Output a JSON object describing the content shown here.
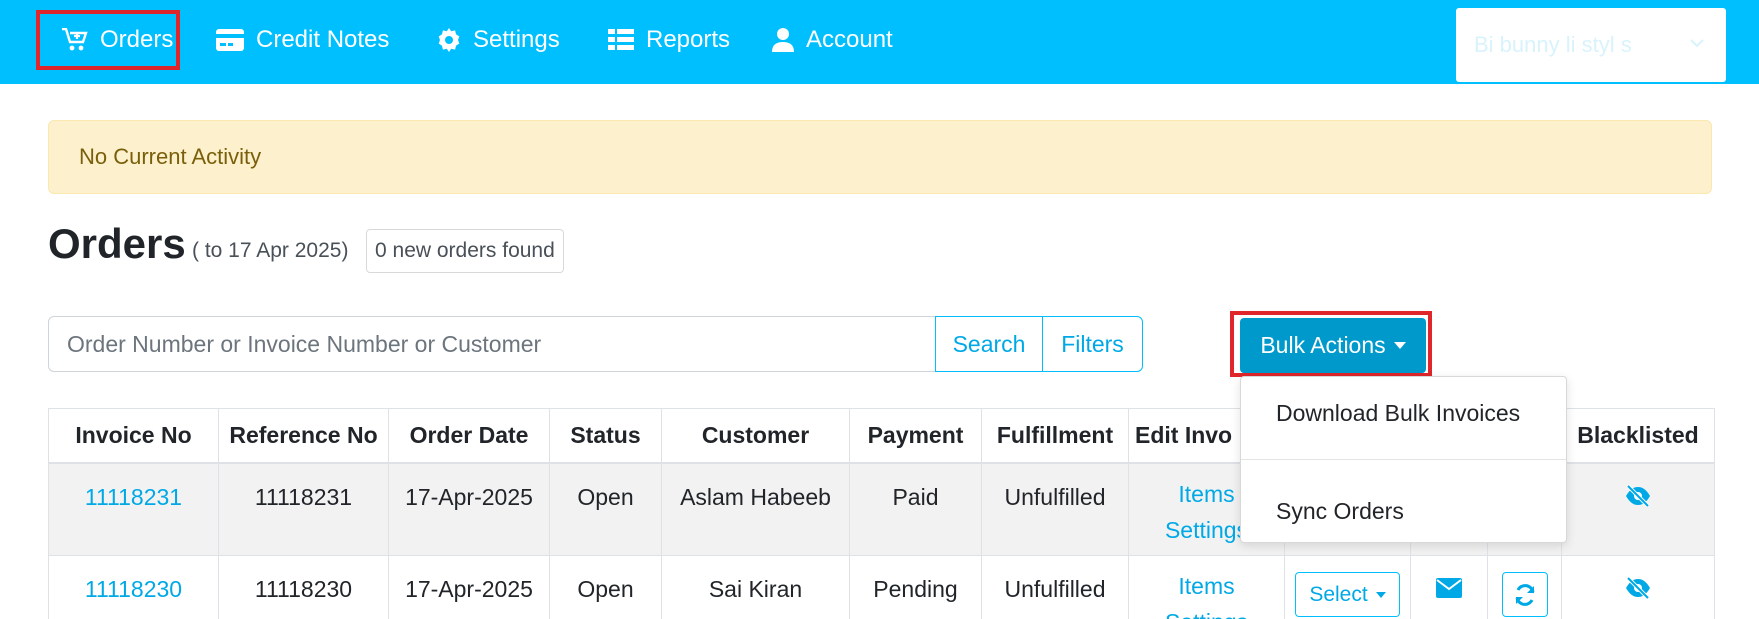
{
  "nav": {
    "orders": "Orders",
    "credit_notes": "Credit Notes",
    "settings": "Settings",
    "reports": "Reports",
    "account": "Account",
    "store": "Bi bunny li styl s"
  },
  "alert": {
    "text": "No Current Activity"
  },
  "heading": {
    "title": "Orders",
    "date_range": "( to 17 Apr 2025)",
    "new_orders": "0 new orders found"
  },
  "search": {
    "placeholder": "Order Number or Invoice Number or Customer",
    "search_label": "Search",
    "filters_label": "Filters"
  },
  "bulk": {
    "label": "Bulk Actions",
    "menu": [
      "Download Bulk Invoices",
      "Sync Orders"
    ]
  },
  "table": {
    "headers": [
      "Invoice No",
      "Reference No",
      "Order Date",
      "Status",
      "Customer",
      "Payment",
      "Fulfillment",
      "Edit Invo",
      "",
      "",
      "",
      "Blacklisted"
    ],
    "rows": [
      {
        "invoice": "11118231",
        "reference": "11118231",
        "date": "17-Apr-2025",
        "status": "Open",
        "customer": "Aslam Habeeb",
        "payment": "Paid",
        "fulfillment": "Unfulfilled",
        "items": "Items",
        "settings": "Settings"
      },
      {
        "invoice": "11118230",
        "reference": "11118230",
        "date": "17-Apr-2025",
        "status": "Open",
        "customer": "Sai Kiran",
        "payment": "Pending",
        "fulfillment": "Unfulfilled",
        "items": "Items",
        "settings": "Settings",
        "select": "Select"
      }
    ]
  },
  "colors": {
    "accent": "#00bfff",
    "link": "#00a9e6",
    "bulk": "#0099cc",
    "highlight": "#e0262b",
    "alert_bg": "#fdf1cd"
  }
}
